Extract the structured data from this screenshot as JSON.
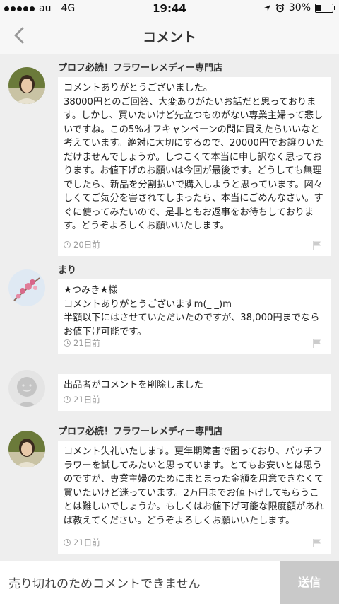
{
  "status_bar": {
    "carrier": "au",
    "network": "4G",
    "time": "19:44",
    "battery": "30%",
    "battery_level": 0.3
  },
  "header": {
    "title": "コメント"
  },
  "comments": [
    {
      "user": "プロフ必読！フラワーレメディー専門店",
      "text": "コメントありがとうございました。\n38000円とのご回答、大変ありがたいお話だと思っております。しかし、買いたいけど先立つものがない専業主婦って悲しいですね。この5%オフキャンペーンの間に買えたらいいなと考えています。絶対に大切にするので、20000円でお譲りいただけませんでしょうか。しつこくて本当に申し訳なく思っております。お値下げのお願いは今回が最後です。どうしても無理でしたら、新品を分割払いで購入しようと思っています。図々しくてご気分を害されてしまったら、本当にごめんなさい。すぐに使ってみたいので、是非ともお返事をお待ちしております。どうぞよろしくお願いいたします。",
      "time": "20日前"
    },
    {
      "user": "まり",
      "text": "★つみき★様\nコメントありがとうございますm(_ _)m\n半額以下にはさせていただいたのですが、38,000円までならお値下げ可能です。",
      "time": "21日前"
    },
    {
      "user": "",
      "text": "出品者がコメントを削除しました",
      "time": "21日前"
    },
    {
      "user": "プロフ必読！フラワーレメディー専門店",
      "text": "コメント失礼いたします。更年期障害で困っており、バッチフラワーを試してみたいと思っています。とてもお安いとは思うのですが、専業主婦のためにまとまった金額を用意できなくて買いたいけど迷っています。2万円までお値下げしてもらうことは難しいでしょうか。もしくはお値下げ可能な限度額があれば教えてください。どうぞよろしくお願いいたします。",
      "time": "21日前"
    }
  ],
  "footer": {
    "placeholder": "売り切れのためコメントできません",
    "send_label": "送信"
  },
  "colors": {
    "background": "#eeeeee",
    "send_disabled": "#c9c9c9"
  },
  "icons": [
    "back-chevron-icon",
    "clock-icon",
    "flag-icon",
    "location-arrow-icon",
    "alarm-icon",
    "battery-icon"
  ]
}
